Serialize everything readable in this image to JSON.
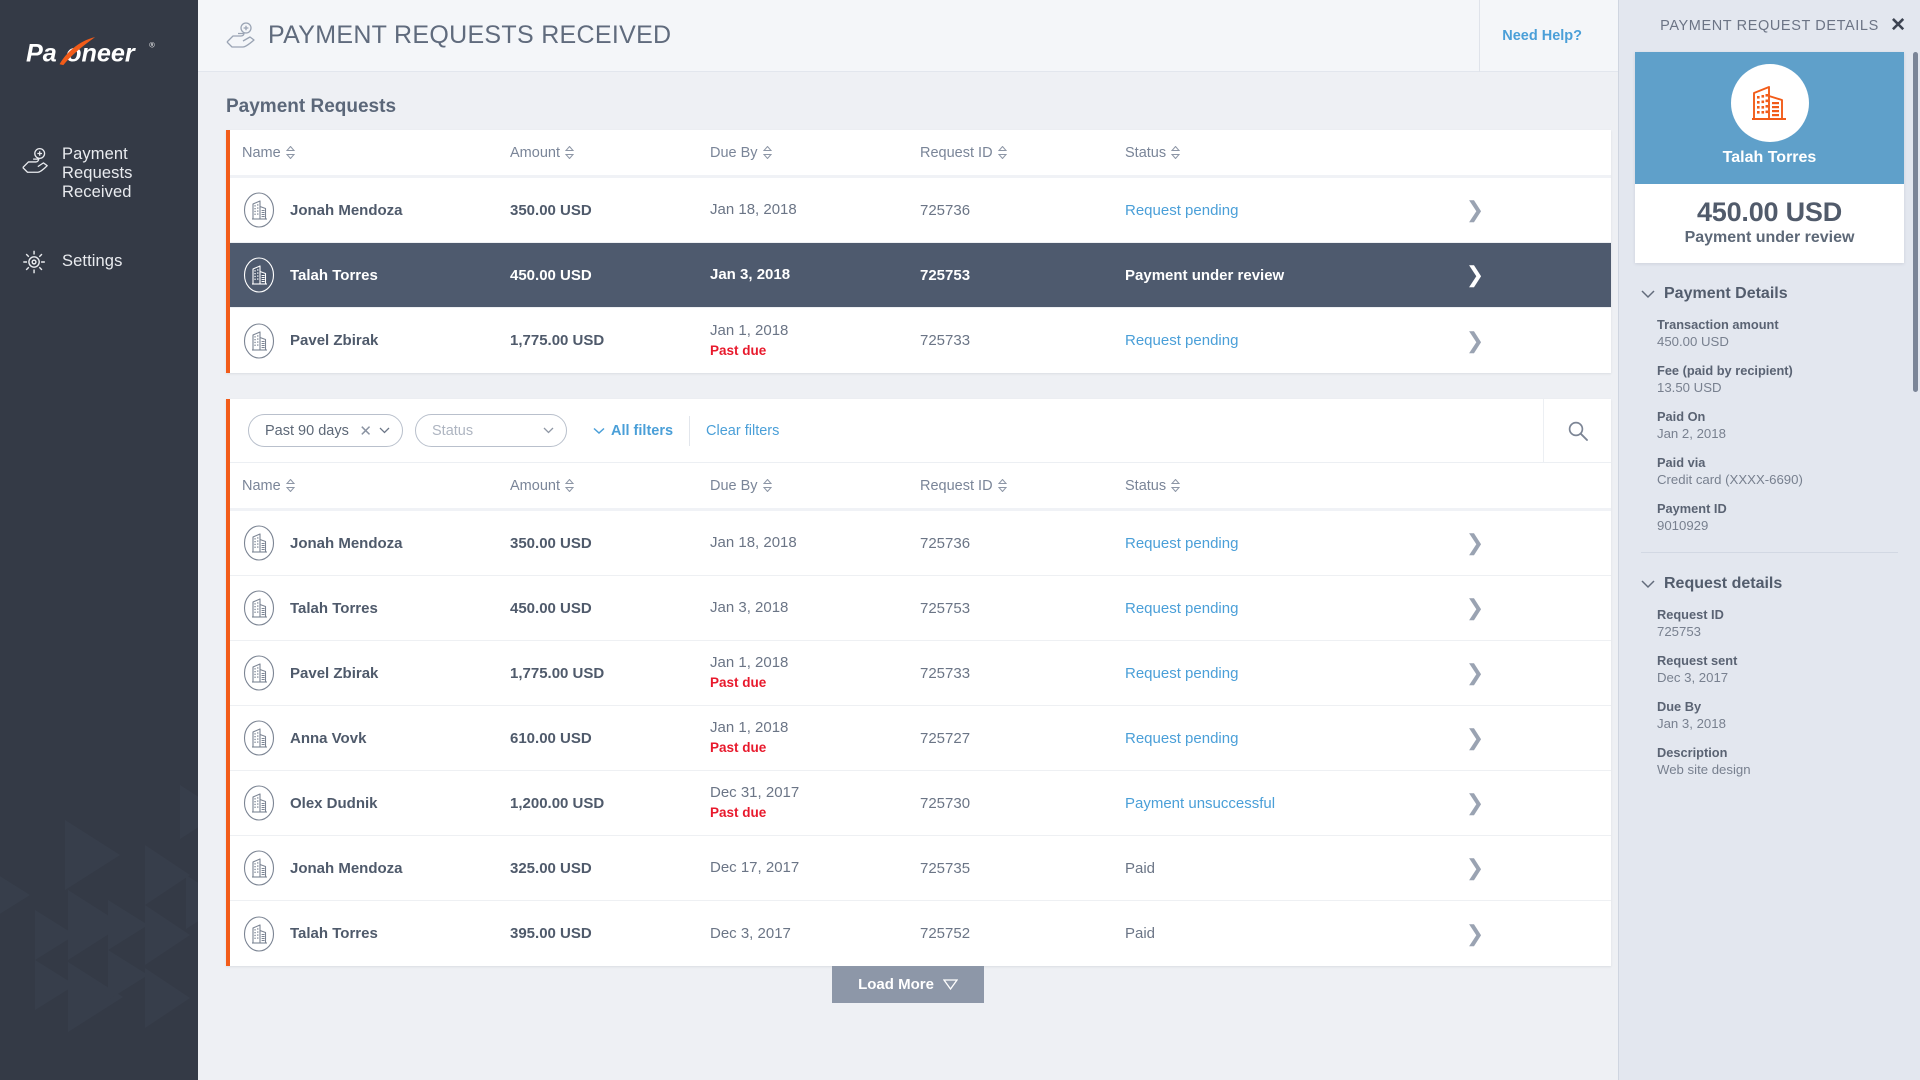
{
  "sidebar": {
    "logo_text": "Payoneer",
    "logo_tm": "®",
    "items": [
      {
        "label": "Payment Requests Received",
        "icon": "hand-coin-icon"
      },
      {
        "label": "Settings",
        "icon": "gear-icon"
      }
    ]
  },
  "topbar": {
    "title": "PAYMENT REQUESTS RECEIVED",
    "icon": "hand-coin-icon",
    "need_help": "Need Help?"
  },
  "main": {
    "section_title": "Payment Requests",
    "columns": [
      "Name",
      "Amount",
      "Due By",
      "Request ID",
      "Status"
    ],
    "top_rows": [
      {
        "name": "Jonah Mendoza",
        "amount": "350.00 USD",
        "due": "Jan 18, 2018",
        "past_due": "",
        "request_id": "725736",
        "status": "Request pending",
        "status_kind": "link",
        "selected": false
      },
      {
        "name": "Talah Torres",
        "amount": "450.00 USD",
        "due": "Jan 3, 2018",
        "past_due": "",
        "request_id": "725753",
        "status": "Payment under review",
        "status_kind": "plain",
        "selected": true
      },
      {
        "name": "Pavel Zbirak",
        "amount": "1,775.00 USD",
        "due": "Jan 1, 2018",
        "past_due": "Past due",
        "request_id": "725733",
        "status": "Request pending",
        "status_kind": "link",
        "selected": false
      }
    ],
    "filters": {
      "date_value": "Past 90 days",
      "status_placeholder": "Status",
      "all_filters": "All filters",
      "clear_filters": "Clear filters",
      "search_icon": "search-icon"
    },
    "list_rows": [
      {
        "name": "Jonah Mendoza",
        "amount": "350.00 USD",
        "due": "Jan 18, 2018",
        "past_due": "",
        "request_id": "725736",
        "status": "Request pending",
        "status_kind": "link"
      },
      {
        "name": "Talah Torres",
        "amount": "450.00 USD",
        "due": "Jan 3, 2018",
        "past_due": "",
        "request_id": "725753",
        "status": "Request pending",
        "status_kind": "link"
      },
      {
        "name": "Pavel Zbirak",
        "amount": "1,775.00 USD",
        "due": "Jan 1, 2018",
        "past_due": "Past due",
        "request_id": "725733",
        "status": "Request pending",
        "status_kind": "link"
      },
      {
        "name": "Anna Vovk",
        "amount": "610.00 USD",
        "due": "Jan 1, 2018",
        "past_due": "Past due",
        "request_id": "725727",
        "status": "Request pending",
        "status_kind": "link"
      },
      {
        "name": "Olex Dudnik",
        "amount": "1,200.00 USD",
        "due": "Dec 31, 2017",
        "past_due": "Past due",
        "request_id": "725730",
        "status": "Payment unsuccessful",
        "status_kind": "link"
      },
      {
        "name": "Jonah Mendoza",
        "amount": "325.00 USD",
        "due": "Dec 17, 2017",
        "past_due": "",
        "request_id": "725735",
        "status": "Paid",
        "status_kind": "plain"
      },
      {
        "name": "Talah Torres",
        "amount": "395.00 USD",
        "due": "Dec 3, 2017",
        "past_due": "",
        "request_id": "725752",
        "status": "Paid",
        "status_kind": "plain"
      }
    ],
    "load_more": "Load More"
  },
  "details_panel": {
    "header": "PAYMENT REQUEST DETAILS",
    "close_icon": "close-icon",
    "card": {
      "avatar_icon": "building-icon",
      "name": "Talah Torres",
      "amount": "450.00 USD",
      "status": "Payment under review"
    },
    "sections": [
      {
        "title": "Payment Details",
        "fields": [
          {
            "label": "Transaction amount",
            "value": "450.00 USD"
          },
          {
            "label": "Fee (paid by recipient)",
            "value": "13.50 USD"
          },
          {
            "label": "Paid On",
            "value": "Jan 2, 2018"
          },
          {
            "label": "Paid via",
            "value": "Credit card (XXXX-6690)"
          },
          {
            "label": "Payment ID",
            "value": "9010929"
          }
        ]
      },
      {
        "title": "Request details",
        "fields": [
          {
            "label": "Request ID",
            "value": "725753"
          },
          {
            "label": "Request sent",
            "value": "Dec 3, 2017"
          },
          {
            "label": "Due By",
            "value": "Jan 3, 2018"
          },
          {
            "label": "Description",
            "value": "Web site design"
          }
        ]
      }
    ]
  },
  "colors": {
    "brand_orange": "#f25c19",
    "sidebar_bg": "#343a46",
    "accent_blue": "#4a9fd8",
    "selected_row": "#4e5a6e",
    "panel_blue": "#5fa0ca",
    "past_due_red": "#e8192c"
  }
}
